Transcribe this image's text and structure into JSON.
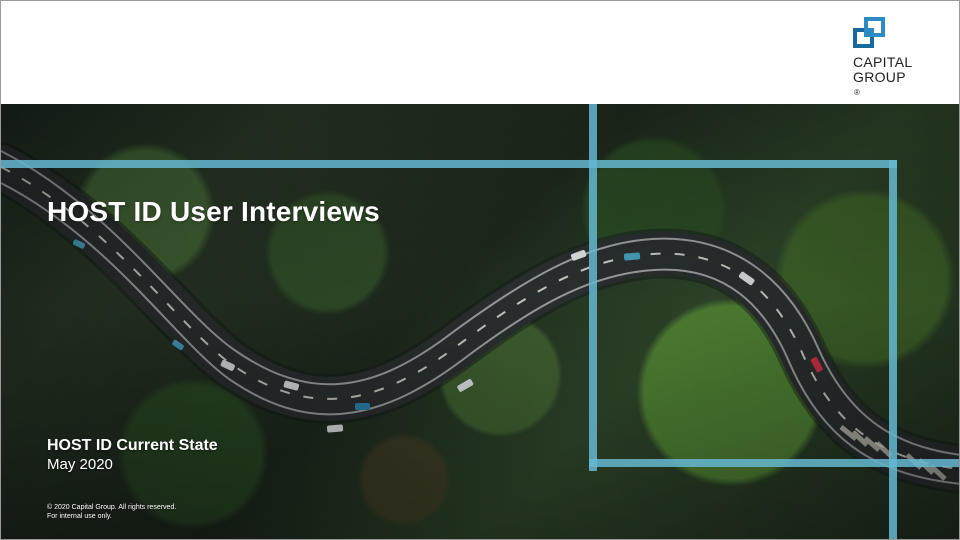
{
  "branding": {
    "logo_icon": "capital-group-logo-mark",
    "logo_line_1": "CAPITAL",
    "logo_line_2": "GROUP",
    "logo_registered": "®"
  },
  "slide": {
    "title": "HOST ID User Interviews",
    "subtitle": "HOST ID Current State",
    "date": "May 2020",
    "footer_line_1": "© 2020 Capital Group. All rights reserved.",
    "footer_line_2": "For internal use only."
  },
  "colors": {
    "accent_line": "#65b8d1",
    "logo_blue": "#2b8bc2",
    "logo_dark_blue": "#176a9b",
    "text_light": "#ffffff",
    "text_dark": "#1f1f1f"
  },
  "background": {
    "scene": "aerial forest road",
    "overlay_icon": "blue-frame-lines"
  }
}
